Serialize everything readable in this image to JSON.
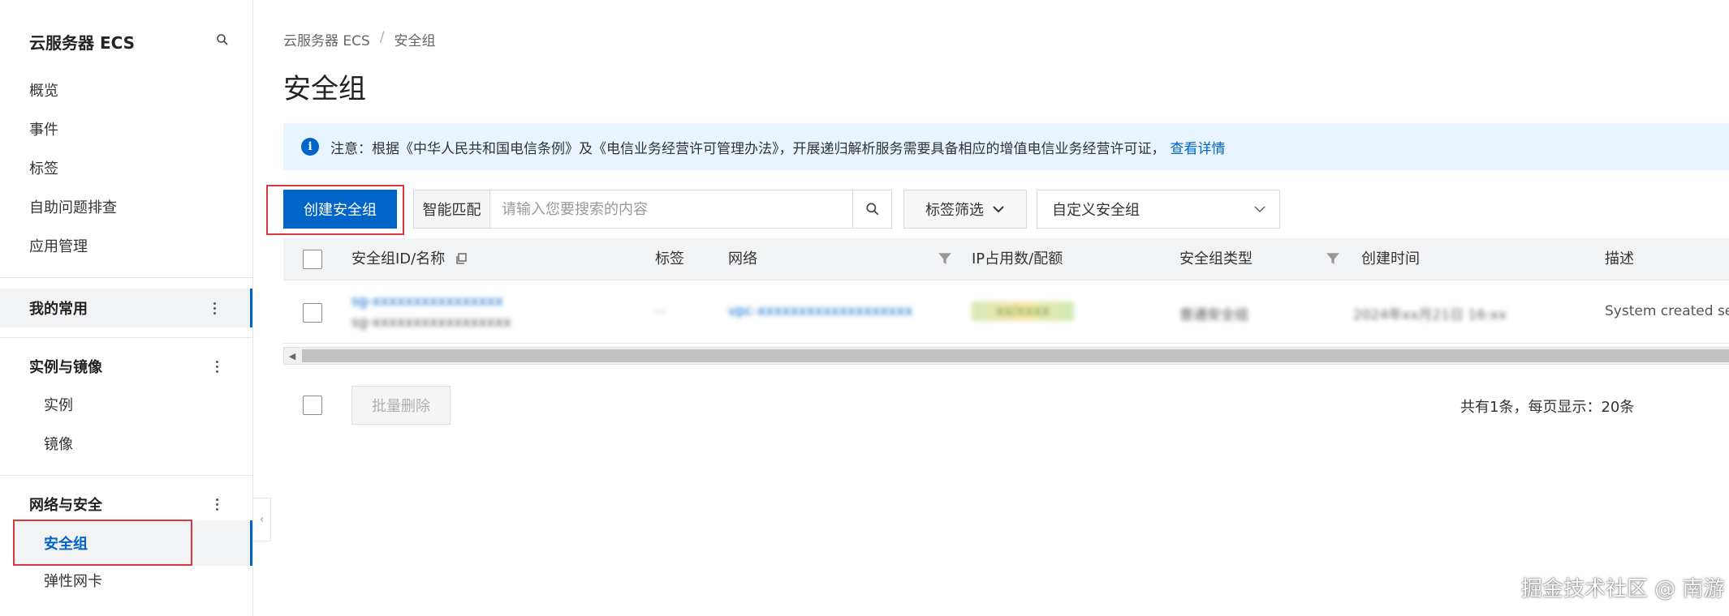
{
  "sidebar": {
    "title": "云服务器 ECS",
    "top_items": [
      "概览",
      "事件",
      "标签",
      "自助问题排查",
      "应用管理"
    ],
    "groups": {
      "favorites": "我的常用",
      "instances_images": {
        "title": "实例与镜像",
        "items": [
          "实例",
          "镜像"
        ]
      },
      "network_security": {
        "title": "网络与安全",
        "active_item": "安全组",
        "items": [
          "弹性网卡"
        ]
      }
    }
  },
  "breadcrumb": [
    "云服务器 ECS",
    "安全组"
  ],
  "page_title": "安全组",
  "notice": {
    "text": "注意：根据《中华人民共和国电信条例》及《电信业务经营许可管理办法》，开展递归解析服务需要具备相应的增值电信业务经营许可证，",
    "link": "查看详情"
  },
  "toolbar": {
    "create_button": "创建安全组",
    "search_mode": "智能匹配",
    "search_placeholder": "请输入您要搜索的内容",
    "tag_filter": "标签筛选",
    "custom_select": "自定义安全组"
  },
  "table": {
    "columns": [
      "安全组ID/名称",
      "标签",
      "网络",
      "IP占用数/配额",
      "安全组类型",
      "创建时间",
      "描述"
    ],
    "rows": [
      {
        "id": "sg-xxxxxxxxxxxxxxxx",
        "name": "sg-xxxxxxxxxxxxxxxxx",
        "tag": "--",
        "network": "vpc-xxxxxxxxxxxxxxxxxxx",
        "ip_quota": "xx/xxxx",
        "type": "普通安全组",
        "created": "2024年xx月21日 16:xx",
        "description": "System created sec"
      }
    ]
  },
  "footer": {
    "batch_delete": "批量删除",
    "pager_text": "共有1条，每页显示：20条"
  },
  "watermark": "掘金技术社区 @ 南游",
  "colors": {
    "primary": "#0064c8",
    "notice_bg": "#e8f4ff",
    "highlight": "#d9363e"
  }
}
